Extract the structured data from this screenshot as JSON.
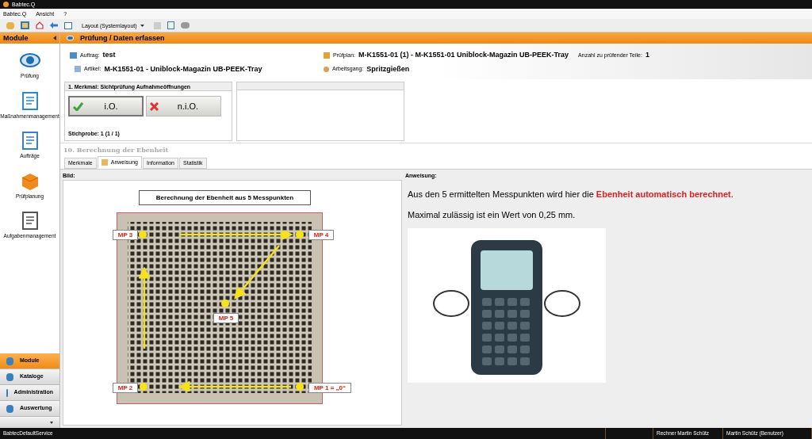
{
  "window": {
    "title": "Babtec.Q"
  },
  "menu": [
    "Babtec.Q",
    "Ansicht",
    "?"
  ],
  "toolbar": {
    "layout": "Layout (Systemlayout)"
  },
  "sidebar": {
    "title": "Module",
    "items": [
      {
        "label": "Prüfung",
        "selected": false
      },
      {
        "label": "Maßnahmenmanagement",
        "selected": false
      },
      {
        "label": "Aufträge",
        "selected": false
      },
      {
        "label": "Prüfplanung",
        "selected": false
      },
      {
        "label": "Aufgabenmanagement",
        "selected": false
      }
    ],
    "nav": [
      {
        "label": "Module",
        "selected": true
      },
      {
        "label": "Kataloge",
        "selected": false
      },
      {
        "label": "Administration",
        "selected": false
      },
      {
        "label": "Auswertung",
        "selected": false
      }
    ]
  },
  "header": {
    "title": "Prüfung / Daten erfassen",
    "auftrag_label": "Auftrag:",
    "auftrag": "test",
    "artikel_label": "Artikel:",
    "artikel": "M-K1551-01 - Uniblock-Magazin UB-PEEK-Tray",
    "pruefplan_label": "Prüfplan:",
    "pruefplan": "M-K1551-01 (1) - M-K1551-01  Uniblock-Magazin UB-PEEK-Tray",
    "anzahl_label": "Anzahl zu prüfender Teile:",
    "anzahl": "1",
    "arbeitsgang_label": "Arbeitsgang:",
    "arbeitsgang": "Spritzgießen"
  },
  "merkmal": {
    "title": "1. Merkmal: Sichtprüfung Aufnahmeöffnungen",
    "buttons": [
      {
        "kind": "ok",
        "label": "i.O.",
        "selected": true
      },
      {
        "kind": "nok",
        "label": "n.i.O.",
        "selected": false
      }
    ],
    "stichprobe": "Stichprobe: 1 (1 / 1)"
  },
  "section_title": "10. Berechnung der Ebenheit",
  "tabs": [
    {
      "label": "Merkmale",
      "selected": false
    },
    {
      "label": "Anweisung",
      "selected": true
    },
    {
      "label": "Information",
      "selected": false
    },
    {
      "label": "Statistik",
      "selected": false
    }
  ],
  "bild": {
    "label": "Bild:",
    "title": "Berechnung der Ebenheit aus 5 Messpunkten",
    "points": [
      "MP 3",
      "MP 4",
      "MP 5",
      "MP 2",
      "MP 1 = „0“"
    ]
  },
  "anweisung": {
    "label": "Anweisung:",
    "paragraphs": [
      "Aus den 5 ermittelten Messpunkten wird hier die **Ebenheit automatisch berechnet**.",
      "Maximal zulässig ist ein Wert von 0,25 mm."
    ]
  },
  "status_bar": [
    "BabtecDefaultService",
    "Rechner Martin Schütz",
    "Martin Schütz (Benutzer)"
  ]
}
